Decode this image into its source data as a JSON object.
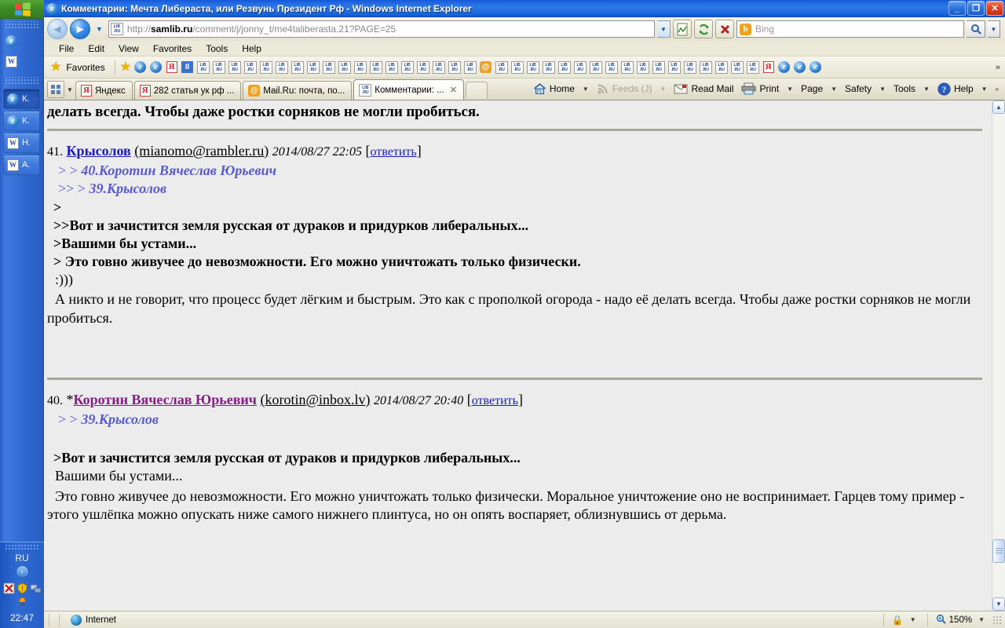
{
  "taskbar": {
    "start_label": "start",
    "quicklaunch": [
      {
        "name": "ie-quicklaunch",
        "icon": "internet-explorer-icon"
      },
      {
        "name": "word-quicklaunch",
        "icon": "word-icon"
      }
    ],
    "tasks": [
      {
        "label": "К.",
        "icon": "internet-explorer-icon",
        "active": true
      },
      {
        "label": "К.",
        "icon": "internet-explorer-icon",
        "active": false
      },
      {
        "label": "Н.",
        "icon": "word-icon",
        "active": false
      },
      {
        "label": "А.",
        "icon": "word-icon",
        "active": false
      }
    ],
    "tray": {
      "language": "RU",
      "show_hidden": "‹",
      "clock": "22:47",
      "icons": [
        "antivirus-icon",
        "security-shield-icon",
        "network-icon",
        "update-icon"
      ]
    }
  },
  "window": {
    "title": "Комментарии: Мечта Либераста, или Резвунь Президент Рф - Windows Internet Explorer",
    "minimize": "_",
    "maximize": "❐",
    "close": "✕"
  },
  "nav": {
    "back": "◄",
    "forward": "►",
    "history_dropdown": "▼",
    "address_value": "http://samlib.ru/comment/j/jonny_t/me4taliberasta.21?PAGE=25",
    "address_host": "samlib.ru",
    "address_prefix": "http://",
    "address_suffix": "/comment/j/jonny_t/me4taliberasta.21?PAGE=25",
    "address_dropdown": "▼",
    "compat_view": "compatibility-view-icon",
    "refresh": "refresh-icon",
    "stop": "stop-icon"
  },
  "search": {
    "provider": "Bing",
    "placeholder": "Bing",
    "value": "",
    "go": "search-icon",
    "dropdown": "▼"
  },
  "menu": {
    "items": [
      "File",
      "Edit",
      "View",
      "Favorites",
      "Tools",
      "Help"
    ]
  },
  "favbar": {
    "favorites_label": "Favorites",
    "add_icon": "add-to-favorites-icon",
    "items": [
      {
        "icon": "internet-explorer-icon"
      },
      {
        "icon": "internet-explorer-icon"
      },
      {
        "icon": "yandex-icon"
      },
      {
        "icon": "google-icon"
      },
      {
        "icon": "librusec-icon"
      },
      {
        "icon": "librusec-icon"
      },
      {
        "icon": "librusec-icon"
      },
      {
        "icon": "librusec-icon"
      },
      {
        "icon": "librusec-icon"
      },
      {
        "icon": "librusec-icon"
      },
      {
        "icon": "librusec-icon"
      },
      {
        "icon": "librusec-icon"
      },
      {
        "icon": "librusec-icon"
      },
      {
        "icon": "librusec-icon"
      },
      {
        "icon": "librusec-icon"
      },
      {
        "icon": "librusec-icon"
      },
      {
        "icon": "librusec-icon"
      },
      {
        "icon": "librusec-icon"
      },
      {
        "icon": "librusec-icon"
      },
      {
        "icon": "librusec-icon"
      },
      {
        "icon": "librusec-icon"
      },
      {
        "icon": "librusec-icon"
      },
      {
        "icon": "mailru-icon"
      },
      {
        "icon": "librusec-icon"
      },
      {
        "icon": "librusec-icon"
      },
      {
        "icon": "librusec-icon"
      },
      {
        "icon": "librusec-icon"
      },
      {
        "icon": "librusec-icon"
      },
      {
        "icon": "librusec-icon"
      },
      {
        "icon": "librusec-icon"
      },
      {
        "icon": "librusec-icon"
      },
      {
        "icon": "librusec-icon"
      },
      {
        "icon": "librusec-icon"
      },
      {
        "icon": "librusec-icon"
      },
      {
        "icon": "librusec-icon"
      },
      {
        "icon": "librusec-icon"
      },
      {
        "icon": "librusec-icon"
      },
      {
        "icon": "librusec-icon"
      },
      {
        "icon": "librusec-icon"
      },
      {
        "icon": "librusec-icon"
      },
      {
        "icon": "yandex-icon"
      },
      {
        "icon": "internet-explorer-icon"
      },
      {
        "icon": "internet-explorer-icon"
      },
      {
        "icon": "internet-explorer-icon"
      }
    ],
    "overflow": "»"
  },
  "tabs": {
    "quick_tabs": "quick-tabs-icon",
    "tab_list_dropdown": "▼",
    "items": [
      {
        "label": "Яндекс",
        "icon": "yandex-icon",
        "active": false
      },
      {
        "label": "282 статья ук рф ...",
        "icon": "yandex-icon",
        "active": false
      },
      {
        "label": "Mail.Ru: почта, по...",
        "icon": "mailru-icon",
        "active": false
      },
      {
        "label": "Комментарии: ...",
        "icon": "librusec-icon",
        "active": true,
        "close": "✕"
      }
    ]
  },
  "commandbar": {
    "items": [
      {
        "label": "Home",
        "icon": "home-icon",
        "dropdown": "▼",
        "dimmed": false
      },
      {
        "label": "Feeds (J)",
        "icon": "feeds-icon",
        "dropdown": "▼",
        "dimmed": true
      },
      {
        "label": "Read Mail",
        "icon": "mail-icon",
        "dropdown": "",
        "dimmed": false
      },
      {
        "label": "Print",
        "icon": "printer-icon",
        "dropdown": "▼",
        "dimmed": false
      },
      {
        "label": "Page",
        "icon": "",
        "dropdown": "▼",
        "dimmed": false
      },
      {
        "label": "Safety",
        "icon": "",
        "dropdown": "▼",
        "dimmed": false
      },
      {
        "label": "Tools",
        "icon": "",
        "dropdown": "▼",
        "dimmed": false
      },
      {
        "label": "Help",
        "icon": "help-icon",
        "dropdown": "▼",
        "dimmed": false
      }
    ],
    "overflow": "»"
  },
  "page": {
    "cut_off_line": "делать всегда. Чтобы даже ростки сорняков не могли пробиться.",
    "comments": [
      {
        "number": "41.",
        "author": "Крысолов",
        "author_visited": false,
        "starred": false,
        "email": "(mianomo@rambler.ru)",
        "date": "2014/08/27 22:05",
        "reply_open": "[",
        "reply": "ответить",
        "reply_close": "]",
        "refs": [
          {
            "gt": "> > ",
            "text": "40.Коротин Вячеслав Юрьевич"
          },
          {
            "gt": ">> > ",
            "text": "39.Крысолов"
          }
        ],
        "body_quotes": [
          ">",
          ">>Вот и зачистится земля русская от дураков и придурков либеральных...",
          ">Вашими бы устами...",
          "> Это говно живучее до невозможности. Его можно уничтожать только физически."
        ],
        "smiley": ":)))",
        "body_text": "А никто и не говорит, что процесс будет лёгким и быстрым. Это как с прополкой огорода - надо её делать всегда. Чтобы даже ростки сорняков не могли пробиться."
      },
      {
        "number": "40.",
        "star": "*",
        "author": "Коротин Вячеслав Юрьевич",
        "author_visited": true,
        "starred": true,
        "email": "(korotin@inbox.lv)",
        "date": "2014/08/27 20:40",
        "reply_open": "[",
        "reply": "ответить",
        "reply_close": "]",
        "refs": [
          {
            "gt": "> > ",
            "text": "39.Крысолов"
          }
        ],
        "quote_line": ">Вот и зачистится земля русская от дураков и придурков либеральных...",
        "plain_line": "Вашими бы устами...",
        "body_text": "Это говно живучее до невозможности. Его можно уничтожать только физически. Моральное уничтожение оно не воспринимает. Гарцев тому пример - этого ушлёпка можно опускать ниже самого нижнего плинтуса, но он опять воспаряет, облизнувшись от дерьма."
      }
    ]
  },
  "scrollbar": {
    "up": "▲",
    "down": "▼"
  },
  "statusbar": {
    "zone": "Internet",
    "zone_icon": "internet-zone-icon",
    "protected_icon": "protected-mode-icon",
    "protected_dropdown": "▼",
    "zoom_icon": "zoom-icon",
    "zoom": "150%",
    "zoom_dropdown": "▼"
  }
}
